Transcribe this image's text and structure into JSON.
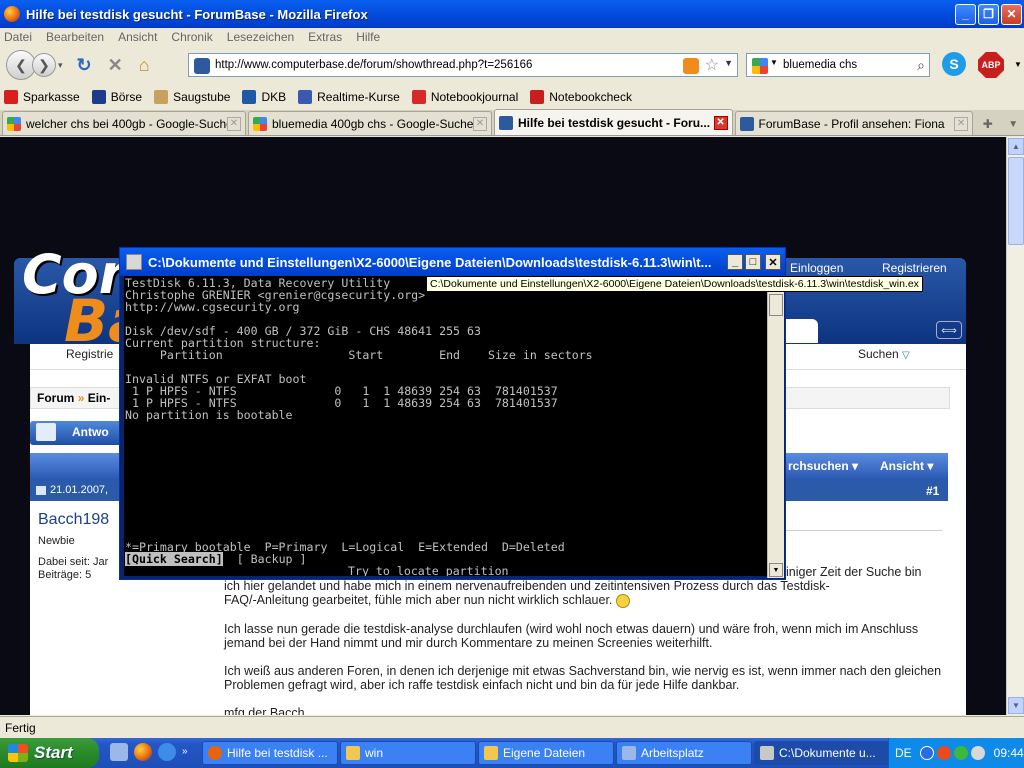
{
  "window": {
    "title": "Hilfe bei testdisk gesucht - ForumBase - Mozilla Firefox"
  },
  "menu": [
    "Datei",
    "Bearbeiten",
    "Ansicht",
    "Chronik",
    "Lesezeichen",
    "Extras",
    "Hilfe"
  ],
  "nav": {
    "url": "http://www.computerbase.de/forum/showthread.php?t=256166",
    "search_value": "bluemedia chs",
    "skype_label": "S",
    "abp_label": "ABP"
  },
  "bookmarks": [
    {
      "label": "Sparkasse",
      "color": "#d81e1e"
    },
    {
      "label": "Börse",
      "color": "#1c3c8c"
    },
    {
      "label": "Saugstube",
      "color": "#c8a060"
    },
    {
      "label": "DKB",
      "color": "#1c5aa8"
    },
    {
      "label": "Realtime-Kurse",
      "color": "#3a5ab0"
    },
    {
      "label": "Notebookjournal",
      "color": "#d82828"
    },
    {
      "label": "Notebookcheck",
      "color": "#c81e1e"
    }
  ],
  "tabs": [
    {
      "label": "welcher chs bei 400gb - Google-Suche",
      "active": false
    },
    {
      "label": "bluemedia 400gb chs - Google-Suche",
      "active": false
    },
    {
      "label": "Hilfe bei testdisk gesucht - Foru...",
      "active": true
    },
    {
      "label": "ForumBase - Profil ansehen: Fiona",
      "active": false
    }
  ],
  "forum": {
    "logo_c": "Comp",
    "logo_b": "Ba",
    "login": "Einloggen",
    "register": "Registrieren",
    "nav_register": "Registrie",
    "nav_search": "Suchen",
    "breadcrumb_forum": "Forum",
    "breadcrumb_next": "Ein-",
    "answer_button": "Antwo",
    "thread_search": "rchsuchen",
    "thread_view": "Ansicht",
    "post_date": "21.01.2007,",
    "post_number": "#1",
    "username": "Bacch198",
    "user_title": "Newbie",
    "user_since": "Dabei seit: Jar",
    "user_posts": "Beiträge: 5",
    "post_paragraphs": [
      "iniger Zeit der Suche bin",
      "ich hier gelandet und habe mich in einem nervenaufreibenden und zeitintensiven Prozess durch das Testdisk-",
      "FAQ/-Anleitung gearbeitet, fühle mich aber nun nicht wirklich schlauer.",
      "Ich lasse nun gerade die testdisk-analyse durchlaufen (wird wohl noch etwas dauern) und wäre froh, wenn mich im Anschluss jemand bei der Hand nimmt und mir durch Kommentare zu meinen Screenies weiterhilft.",
      "Ich weiß aus anderen Foren, in denen ich derjenige mit etwas Sachverstand bin, wie nervig es ist, wenn immer nach den gleichen Problemen gefragt wird, aber ich raffe testdisk einfach nicht und bin da für jede Hilfe dankbar.",
      "mfg der Bacch"
    ]
  },
  "console": {
    "title": "C:\\Dokumente und Einstellungen\\X2-6000\\Eigene Dateien\\Downloads\\testdisk-6.11.3\\win\\t...",
    "tooltip": "C:\\Dokumente und Einstellungen\\X2-6000\\Eigene Dateien\\Downloads\\testdisk-6.11.3\\win\\testdisk_win.ex",
    "lines": [
      "TestDisk 6.11.3, Data Recovery Utility",
      "Christophe GRENIER <grenier@cgsecurity.org>",
      "http://www.cgsecurity.org",
      "",
      "Disk /dev/sdf - 400 GB / 372 GiB - CHS 48641 255 63",
      "Current partition structure:",
      "     Partition                  Start        End    Size in sectors",
      "",
      "Invalid NTFS or EXFAT boot",
      " 1 P HPFS - NTFS              0   1  1 48639 254 63  781401537",
      " 1 P HPFS - NTFS              0   1  1 48639 254 63  781401537",
      "No partition is bootable",
      "",
      "",
      "",
      "",
      "",
      "",
      "",
      "",
      "",
      "",
      "*=Primary bootable  P=Primary  L=Logical  E=Extended  D=Deleted"
    ],
    "menu_quick_search": "[Quick Search]",
    "menu_backup": " [ Backup ]",
    "hint": "Try to locate partition"
  },
  "status": "Fertig",
  "taskbar": {
    "start": "Start",
    "buttons": [
      {
        "label": "Hilfe bei testdisk ...",
        "color": "#e8640c",
        "active": false
      },
      {
        "label": "win",
        "color": "#f0c850",
        "active": false
      },
      {
        "label": "Eigene Dateien",
        "color": "#f0c850",
        "active": false
      },
      {
        "label": "Arbeitsplatz",
        "color": "#9cb8e8",
        "active": false
      },
      {
        "label": "C:\\Dokumente u...",
        "color": "#c8c8c8",
        "active": true
      }
    ],
    "lang": "DE",
    "clock": "09:44"
  }
}
